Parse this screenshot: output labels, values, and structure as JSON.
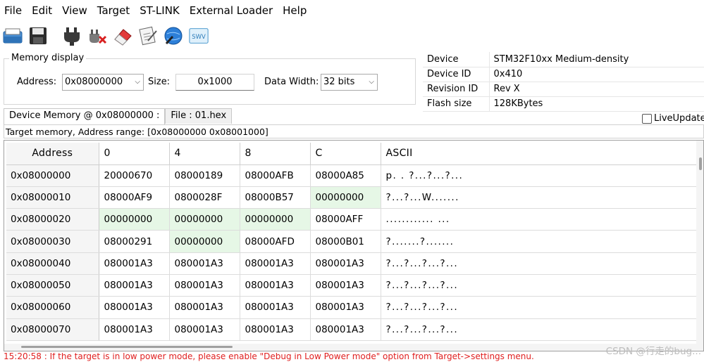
{
  "menu": [
    "File",
    "Edit",
    "View",
    "Target",
    "ST-LINK",
    "External Loader",
    "Help"
  ],
  "toolbar": {
    "icons": [
      "open-file-icon",
      "save-icon",
      "connect-plug-icon",
      "disconnect-icon",
      "erase-icon",
      "verify-icon",
      "program-globe-icon",
      "swv-icon"
    ],
    "swv_label": "SWV"
  },
  "memory_display": {
    "legend": "Memory display",
    "address_label": "Address:",
    "address_value": "0x08000000",
    "size_label": "Size:",
    "size_value": "0x1000",
    "data_width_label": "Data Width:",
    "data_width_value": "32 bits"
  },
  "device_info": [
    {
      "key": "Device",
      "value": "STM32F10xx Medium-density"
    },
    {
      "key": "Device ID",
      "value": "0x410"
    },
    {
      "key": "Revision ID",
      "value": "Rev X"
    },
    {
      "key": "Flash size",
      "value": "128KBytes"
    }
  ],
  "tabs": [
    "Device Memory @ 0x08000000 :",
    "File : 01.hex"
  ],
  "live_update": {
    "label": "LiveUpdate",
    "checked": false
  },
  "range_text": "Target memory, Address range: [0x08000000 0x08001000]",
  "grid": {
    "headers": [
      "Address",
      "0",
      "4",
      "8",
      "C",
      "ASCII"
    ],
    "rows": [
      {
        "addr": "0x08000000",
        "c0": "20000670",
        "c4": "08000189",
        "c8": "08000AFB",
        "cC": "08000A85",
        "ascii": "p. .  ?...?...?..."
      },
      {
        "addr": "0x08000010",
        "c0": "08000AF9",
        "c4": "0800028F",
        "c8": "08000B57",
        "cC": "00000000",
        "ascii": "?...?...W......."
      },
      {
        "addr": "0x08000020",
        "c0": "00000000",
        "c4": "00000000",
        "c8": "00000000",
        "cC": "08000AFF",
        "ascii": "............    ..."
      },
      {
        "addr": "0x08000030",
        "c0": "08000291",
        "c4": "00000000",
        "c8": "08000AFD",
        "cC": "08000B01",
        "ascii": "?.......?......."
      },
      {
        "addr": "0x08000040",
        "c0": "080001A3",
        "c4": "080001A3",
        "c8": "080001A3",
        "cC": "080001A3",
        "ascii": "?...?...?...?..."
      },
      {
        "addr": "0x08000050",
        "c0": "080001A3",
        "c4": "080001A3",
        "c8": "080001A3",
        "cC": "080001A3",
        "ascii": "?...?...?...?..."
      },
      {
        "addr": "0x08000060",
        "c0": "080001A3",
        "c4": "080001A3",
        "c8": "080001A3",
        "cC": "080001A3",
        "ascii": "?...?...?...?..."
      },
      {
        "addr": "0x08000070",
        "c0": "080001A3",
        "c4": "080001A3",
        "c8": "080001A3",
        "cC": "080001A3",
        "ascii": "?...?...?...?..."
      }
    ]
  },
  "log_line": "15:20:58 : If the target is in low power mode, please enable \"Debug in Low Power mode\" option from Target->settings menu.",
  "watermark": "CSDN @行走的bug...",
  "colors": {
    "zero_cell": "#e6f7e6",
    "log_text": "#e02020"
  }
}
